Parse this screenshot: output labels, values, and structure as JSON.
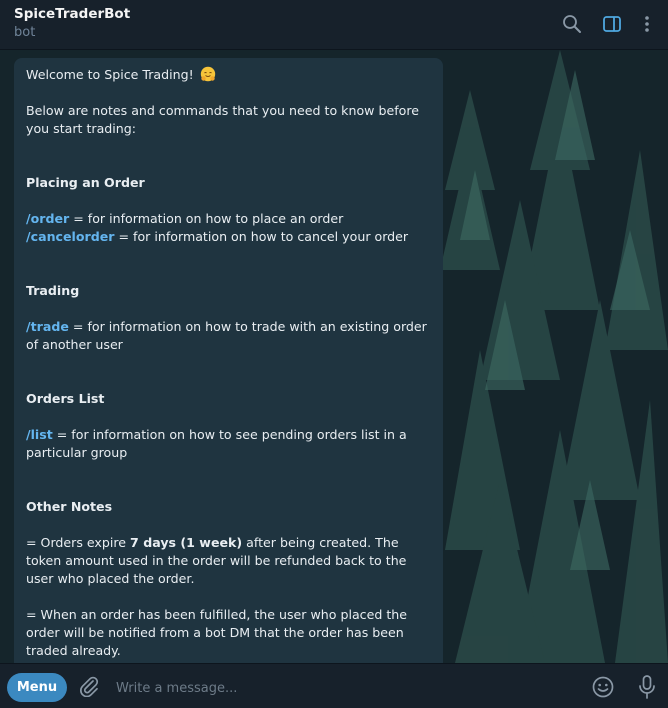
{
  "header": {
    "title": "SpiceTraderBot",
    "subtitle": "bot",
    "icons": [
      "search-icon",
      "sidebar-toggle-icon",
      "more-vertical-icon"
    ],
    "accent": "#4fa8e0"
  },
  "message": {
    "welcome": "Welcome to Spice Trading!",
    "welcome_emoji": "hugging-face",
    "intro": "Below are notes and commands that you need to know before you start trading:",
    "sections": {
      "placing": {
        "title": "Placing an Order",
        "order_cmd": "/order",
        "order_text": " = for information on how to place an order",
        "cancel_cmd": "/cancelorder",
        "cancel_text": " = for information on how to cancel your order"
      },
      "trading": {
        "title": "Trading",
        "trade_cmd": "/trade",
        "trade_text": " = for information on how to trade with an existing order of another user"
      },
      "orders_list": {
        "title": "Orders List",
        "list_cmd": "/list",
        "list_text": " = for information on how to see pending orders list in a particular group"
      },
      "other": {
        "title": "Other Notes",
        "note1_pre": "= Orders expire ",
        "note1_bold": "7 days (1 week)",
        "note1_post": " after being created. The token amount used in the order will be refunded back to the user who placed the order.",
        "note2": "= When an order has been fulfilled, the user who placed the order will be notified from a bot DM that the order has been traded already."
      }
    },
    "colors": {
      "bubble": "#1f3440",
      "command": "#64b5ef"
    }
  },
  "composer": {
    "menu_label": "Menu",
    "placeholder": "Write a message...",
    "value": "",
    "icons": [
      "attach-icon",
      "emoji-icon",
      "microphone-icon"
    ],
    "menu_color": "#3b89c0"
  }
}
